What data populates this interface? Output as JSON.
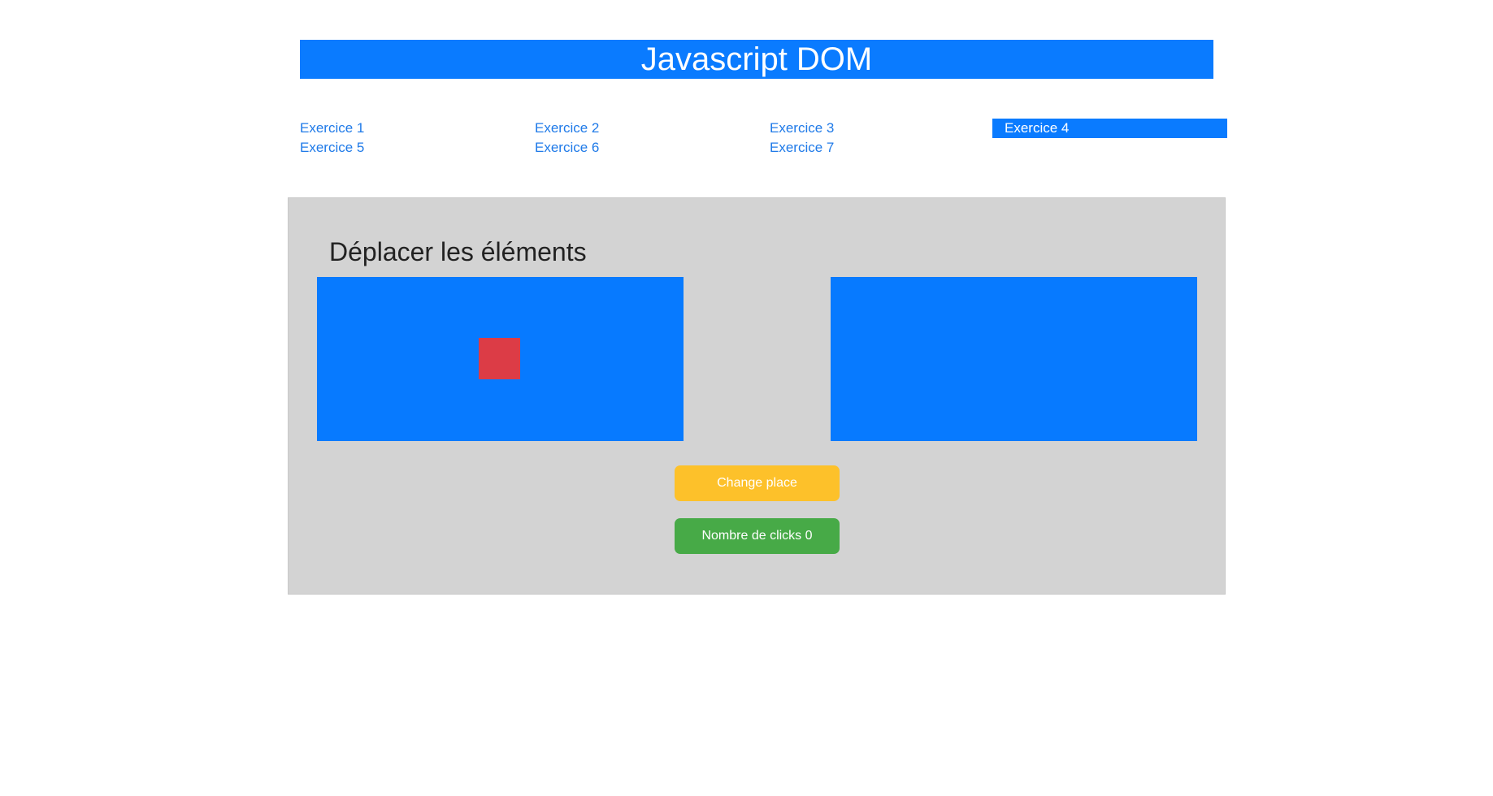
{
  "header": {
    "title": "Javascript DOM"
  },
  "nav": {
    "items": [
      {
        "label": "Exercice 1",
        "active": false
      },
      {
        "label": "Exercice 2",
        "active": false
      },
      {
        "label": "Exercice 3",
        "active": false
      },
      {
        "label": "Exercice 4",
        "active": true
      },
      {
        "label": "Exercice 5",
        "active": false
      },
      {
        "label": "Exercice 6",
        "active": false
      },
      {
        "label": "Exercice 7",
        "active": false
      }
    ]
  },
  "main": {
    "title": "Déplacer les éléments",
    "change_button_label": "Change place",
    "clicks_button_label": "Nombre de clicks 0"
  },
  "colors": {
    "primary": "#0a7bff",
    "panel_background": "#d3d3d3",
    "square": "#dc3c46",
    "warning": "#fdc12a",
    "success": "#47aa47"
  }
}
